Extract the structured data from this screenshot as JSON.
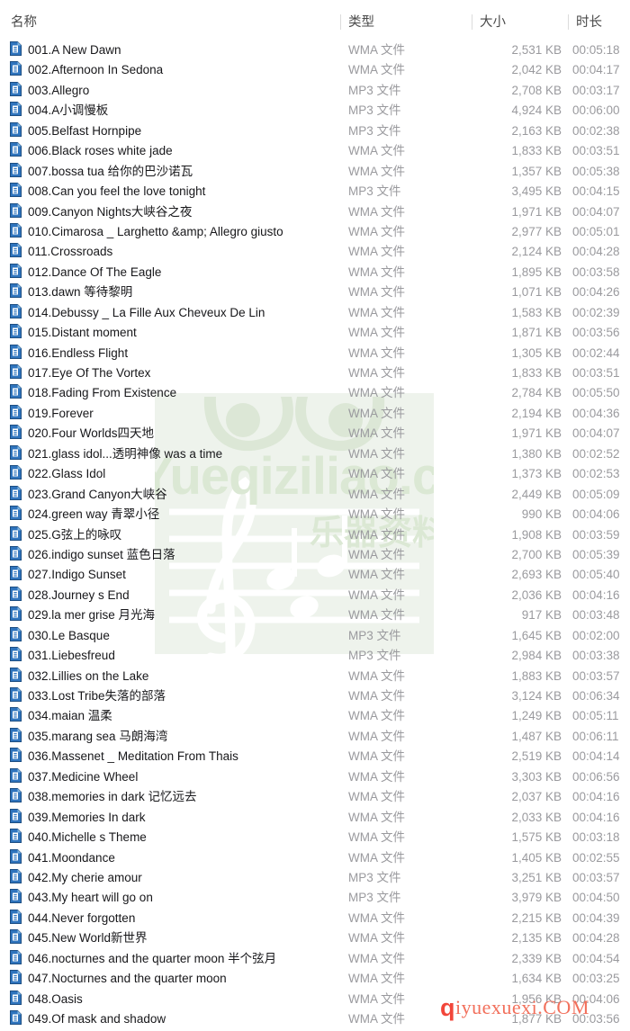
{
  "columns": {
    "name": "名称",
    "type": "类型",
    "size": "大小",
    "duration": "时长"
  },
  "watermarks": {
    "primary_text": "Yueqiziliao.com",
    "primary_subtext": "乐器资料网",
    "primary_color": "#e3ece0",
    "secondary_prefix": "q",
    "secondary_text": "iyuexuexi.COM",
    "secondary_color": "#f2705c"
  },
  "icon": {
    "name": "media-file-icon",
    "color": "#2b6cb8"
  },
  "files": [
    {
      "name": "001.A New Dawn",
      "type": "WMA 文件",
      "size": "2,531 KB",
      "duration": "00:05:18"
    },
    {
      "name": "002.Afternoon In Sedona",
      "type": "WMA 文件",
      "size": "2,042 KB",
      "duration": "00:04:17"
    },
    {
      "name": "003.Allegro",
      "type": "MP3 文件",
      "size": "2,708 KB",
      "duration": "00:03:17"
    },
    {
      "name": "004.A小调慢板",
      "type": "MP3 文件",
      "size": "4,924 KB",
      "duration": "00:06:00"
    },
    {
      "name": "005.Belfast Hornpipe",
      "type": "MP3 文件",
      "size": "2,163 KB",
      "duration": "00:02:38"
    },
    {
      "name": "006.Black roses white jade",
      "type": "WMA 文件",
      "size": "1,833 KB",
      "duration": "00:03:51"
    },
    {
      "name": "007.bossa tua 给你的巴沙诺瓦",
      "type": "WMA 文件",
      "size": "1,357 KB",
      "duration": "00:05:38"
    },
    {
      "name": "008.Can you feel the love tonight",
      "type": "MP3 文件",
      "size": "3,495 KB",
      "duration": "00:04:15"
    },
    {
      "name": "009.Canyon Nights大峡谷之夜",
      "type": "WMA 文件",
      "size": "1,971 KB",
      "duration": "00:04:07"
    },
    {
      "name": "010.Cimarosa _ Larghetto &amp; Allegro giusto",
      "type": "WMA 文件",
      "size": "2,977 KB",
      "duration": "00:05:01"
    },
    {
      "name": "011.Crossroads",
      "type": "WMA 文件",
      "size": "2,124 KB",
      "duration": "00:04:28"
    },
    {
      "name": "012.Dance Of The Eagle",
      "type": "WMA 文件",
      "size": "1,895 KB",
      "duration": "00:03:58"
    },
    {
      "name": "013.dawn 等待黎明",
      "type": "WMA 文件",
      "size": "1,071 KB",
      "duration": "00:04:26"
    },
    {
      "name": "014.Debussy _ La Fille Aux Cheveux De Lin",
      "type": "WMA 文件",
      "size": "1,583 KB",
      "duration": "00:02:39"
    },
    {
      "name": "015.Distant moment",
      "type": "WMA 文件",
      "size": "1,871 KB",
      "duration": "00:03:56"
    },
    {
      "name": "016.Endless Flight",
      "type": "WMA 文件",
      "size": "1,305 KB",
      "duration": "00:02:44"
    },
    {
      "name": "017.Eye Of The Vortex",
      "type": "WMA 文件",
      "size": "1,833 KB",
      "duration": "00:03:51"
    },
    {
      "name": "018.Fading From Existence",
      "type": "WMA 文件",
      "size": "2,784 KB",
      "duration": "00:05:50"
    },
    {
      "name": "019.Forever",
      "type": "WMA 文件",
      "size": "2,194 KB",
      "duration": "00:04:36"
    },
    {
      "name": "020.Four Worlds四天地",
      "type": "WMA 文件",
      "size": "1,971 KB",
      "duration": "00:04:07"
    },
    {
      "name": "021.glass idol...透明神像 was a time",
      "type": "WMA 文件",
      "size": "1,380 KB",
      "duration": "00:02:52"
    },
    {
      "name": "022.Glass Idol",
      "type": "WMA 文件",
      "size": "1,373 KB",
      "duration": "00:02:53"
    },
    {
      "name": "023.Grand Canyon大峡谷",
      "type": "WMA 文件",
      "size": "2,449 KB",
      "duration": "00:05:09"
    },
    {
      "name": "024.green way 青翠小径",
      "type": "WMA 文件",
      "size": "990 KB",
      "duration": "00:04:06"
    },
    {
      "name": "025.G弦上的咏叹",
      "type": "WMA 文件",
      "size": "1,908 KB",
      "duration": "00:03:59"
    },
    {
      "name": "026.indigo sunset 蓝色日落",
      "type": "WMA 文件",
      "size": "2,700 KB",
      "duration": "00:05:39"
    },
    {
      "name": "027.Indigo Sunset",
      "type": "WMA 文件",
      "size": "2,693 KB",
      "duration": "00:05:40"
    },
    {
      "name": "028.Journey s End",
      "type": "WMA 文件",
      "size": "2,036 KB",
      "duration": "00:04:16"
    },
    {
      "name": "029.la mer grise 月光海",
      "type": "WMA 文件",
      "size": "917 KB",
      "duration": "00:03:48"
    },
    {
      "name": "030.Le Basque",
      "type": "MP3 文件",
      "size": "1,645 KB",
      "duration": "00:02:00"
    },
    {
      "name": "031.Liebesfreud",
      "type": "MP3 文件",
      "size": "2,984 KB",
      "duration": "00:03:38"
    },
    {
      "name": "032.Lillies on the Lake",
      "type": "WMA 文件",
      "size": "1,883 KB",
      "duration": "00:03:57"
    },
    {
      "name": "033.Lost Tribe失落的部落",
      "type": "WMA 文件",
      "size": "3,124 KB",
      "duration": "00:06:34"
    },
    {
      "name": "034.maian 温柔",
      "type": "WMA 文件",
      "size": "1,249 KB",
      "duration": "00:05:11"
    },
    {
      "name": "035.marang sea 马朗海湾",
      "type": "WMA 文件",
      "size": "1,487 KB",
      "duration": "00:06:11"
    },
    {
      "name": "036.Massenet _ Meditation From Thais",
      "type": "WMA 文件",
      "size": "2,519 KB",
      "duration": "00:04:14"
    },
    {
      "name": "037.Medicine Wheel",
      "type": "WMA 文件",
      "size": "3,303 KB",
      "duration": "00:06:56"
    },
    {
      "name": "038.memories in dark 记忆远去",
      "type": "WMA 文件",
      "size": "2,037 KB",
      "duration": "00:04:16"
    },
    {
      "name": "039.Memories In dark",
      "type": "WMA 文件",
      "size": "2,033 KB",
      "duration": "00:04:16"
    },
    {
      "name": "040.Michelle s Theme",
      "type": "WMA 文件",
      "size": "1,575 KB",
      "duration": "00:03:18"
    },
    {
      "name": "041.Moondance",
      "type": "WMA 文件",
      "size": "1,405 KB",
      "duration": "00:02:55"
    },
    {
      "name": "042.My cherie amour",
      "type": "MP3 文件",
      "size": "3,251 KB",
      "duration": "00:03:57"
    },
    {
      "name": "043.My heart will go on",
      "type": "MP3 文件",
      "size": "3,979 KB",
      "duration": "00:04:50"
    },
    {
      "name": "044.Never forgotten",
      "type": "WMA 文件",
      "size": "2,215 KB",
      "duration": "00:04:39"
    },
    {
      "name": "045.New World新世界",
      "type": "WMA 文件",
      "size": "2,135 KB",
      "duration": "00:04:28"
    },
    {
      "name": "046.nocturnes and the quarter moon 半个弦月",
      "type": "WMA 文件",
      "size": "2,339 KB",
      "duration": "00:04:54"
    },
    {
      "name": "047.Nocturnes and the quarter moon",
      "type": "WMA 文件",
      "size": "1,634 KB",
      "duration": "00:03:25"
    },
    {
      "name": "048.Oasis",
      "type": "WMA 文件",
      "size": "1,956 KB",
      "duration": "00:04:06"
    },
    {
      "name": "049.Of mask and shadow",
      "type": "WMA 文件",
      "size": "1,877 KB",
      "duration": "00:03:56"
    }
  ]
}
